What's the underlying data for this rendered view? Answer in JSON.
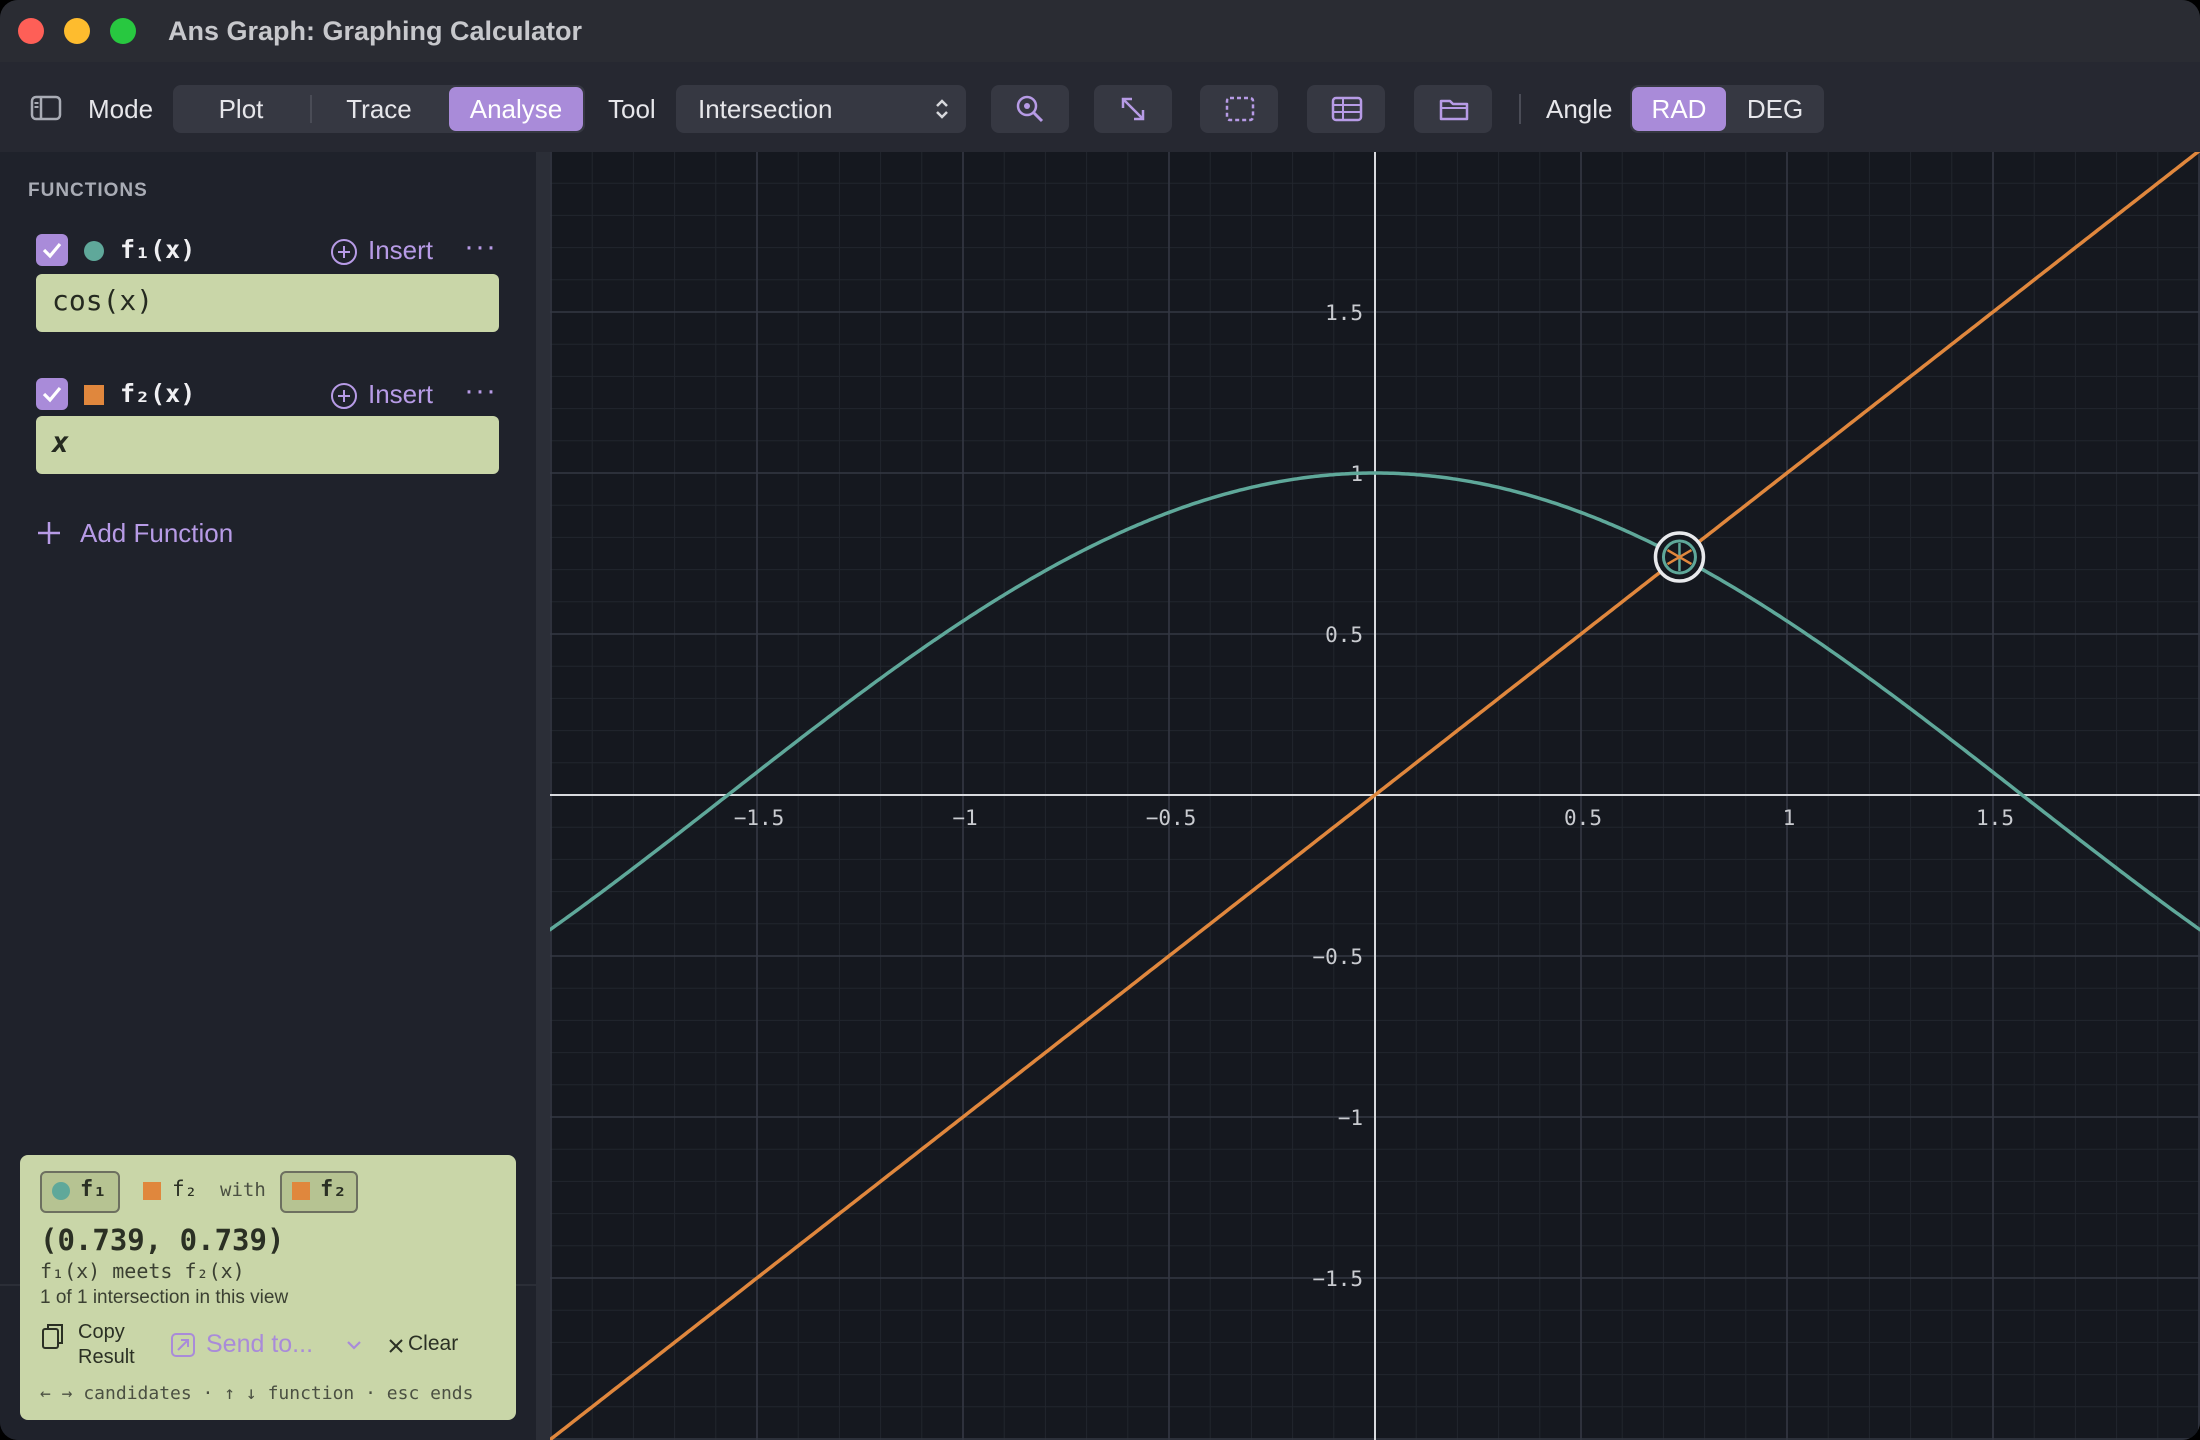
{
  "window": {
    "title": "Ans Graph: Graphing Calculator"
  },
  "toolbar": {
    "sidebar_toggle_icon": "sidebar-toggle-icon",
    "mode_label": "Mode",
    "modes": [
      "Plot",
      "Trace",
      "Analyse"
    ],
    "active_mode": "Analyse",
    "tool_label": "Tool",
    "tool_value": "Intersection",
    "icons": [
      "zoom-icon",
      "fit-expand-icon",
      "selection-rect-icon",
      "table-icon",
      "folder-icon"
    ],
    "angle_label": "Angle",
    "angle_options": [
      "RAD",
      "DEG"
    ],
    "active_angle": "RAD"
  },
  "sidebar": {
    "heading": "FUNCTIONS",
    "functions": [
      {
        "name": "f₁(x)",
        "expression": "cos(x)",
        "color": "#5fa89a",
        "marker": "circle",
        "enabled": true,
        "insert_label": "Insert",
        "more_label": "···"
      },
      {
        "name": "f₂(x)",
        "expression": "x",
        "color": "#e0873d",
        "marker": "square",
        "enabled": true,
        "insert_label": "Insert",
        "more_label": "···"
      }
    ],
    "add_function_label": "Add Function"
  },
  "result": {
    "chip_a": "f₁",
    "chip_b": "f₂",
    "with_label": "with",
    "chip_c": "f₂",
    "coordinates": "(0.739, 0.739)",
    "meets_text": "f₁(x) meets f₂(x)",
    "count_text": "1 of 1 intersection in this view",
    "copy_line1": "Copy",
    "copy_line2": "Result",
    "send_label": "Send to...",
    "clear_label": "Clear",
    "hint": "← → candidates · ↑ ↓ function · esc ends"
  },
  "chart_data": {
    "type": "line",
    "x_ticks": [
      "−1.5",
      "−1",
      "−0.5",
      "0.5",
      "1",
      "1.5"
    ],
    "y_ticks": [
      "1.5",
      "1",
      "0.5",
      "−0.5",
      "−1",
      "−1.5"
    ],
    "xlim": [
      -2.0,
      2.0
    ],
    "ylim": [
      -2.0,
      2.0
    ],
    "grid": true,
    "series": [
      {
        "name": "f₁(x)",
        "expression": "cos(x)",
        "color": "#5fa89a"
      },
      {
        "name": "f₂(x)",
        "expression": "x",
        "color": "#e0873d"
      }
    ],
    "intersection": {
      "x": 0.739,
      "y": 0.739
    }
  }
}
